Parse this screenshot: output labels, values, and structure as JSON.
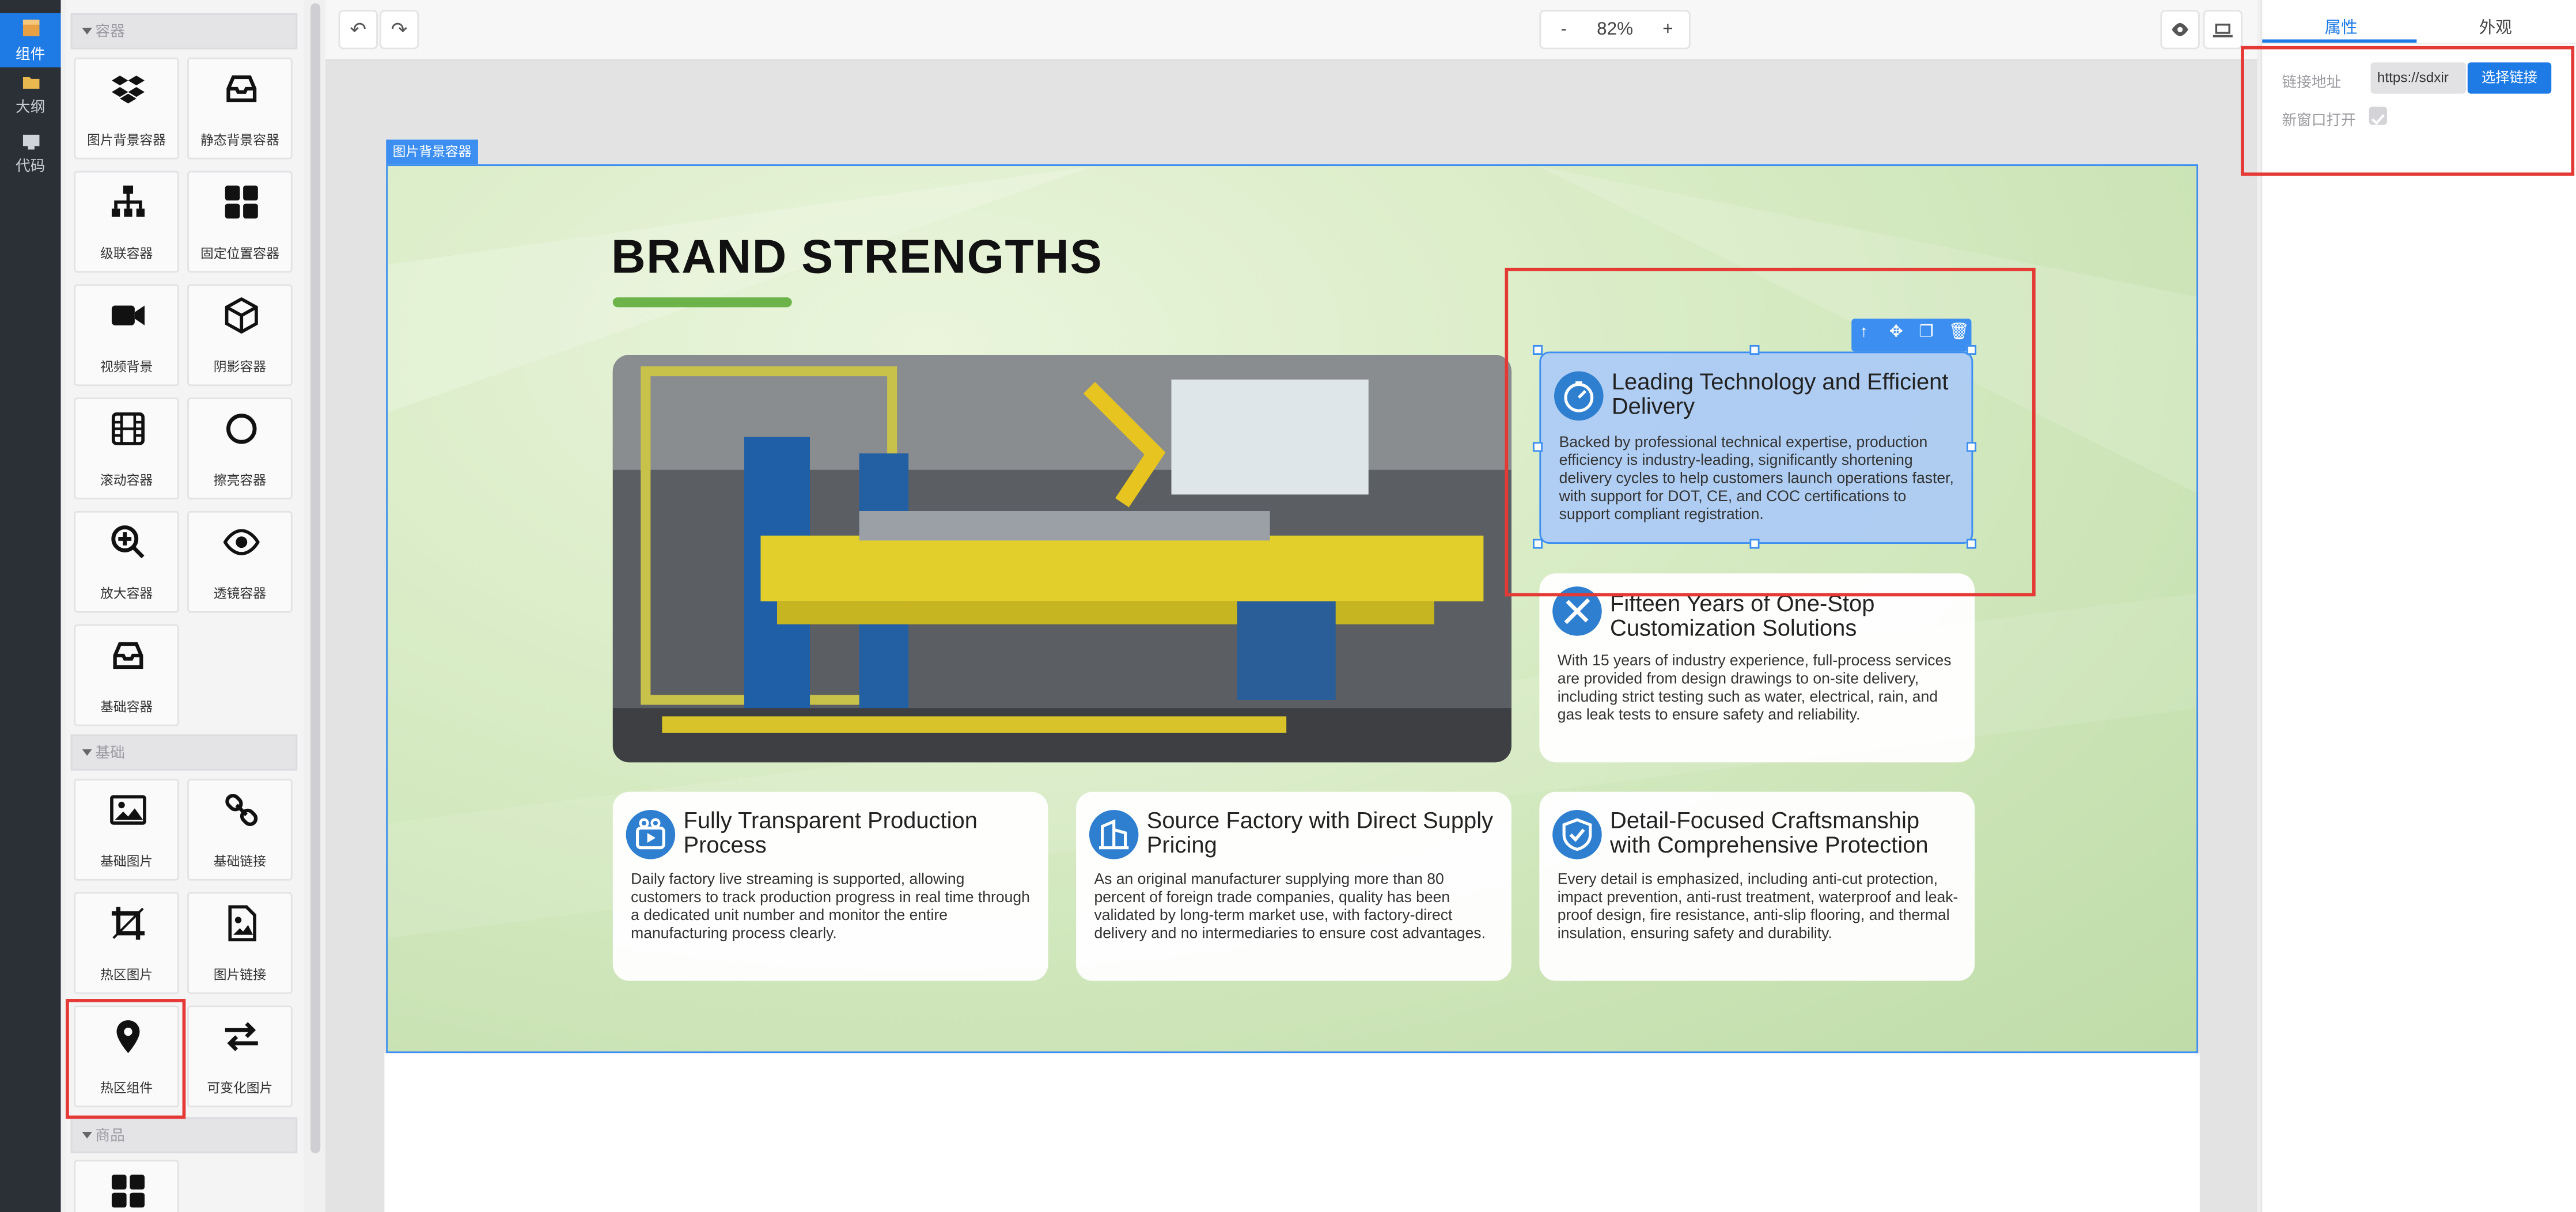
{
  "rail": {
    "items": [
      {
        "label": "组件",
        "icon": "cube-icon"
      },
      {
        "label": "大纲",
        "icon": "folder-icon"
      },
      {
        "label": "代码",
        "icon": "monitor-icon"
      }
    ]
  },
  "panel": {
    "sections": [
      "容器",
      "基础",
      "商品"
    ],
    "container_tiles": [
      {
        "label": "图片背景容器",
        "icon": "dropbox-icon"
      },
      {
        "label": "静态背景容器",
        "icon": "inbox-icon"
      },
      {
        "label": "级联容器",
        "icon": "sitemap-icon"
      },
      {
        "label": "固定位置容器",
        "icon": "grid-icon"
      },
      {
        "label": "视频背景",
        "icon": "video-icon"
      },
      {
        "label": "阴影容器",
        "icon": "box-icon"
      },
      {
        "label": "滚动容器",
        "icon": "film-icon"
      },
      {
        "label": "擦亮容器",
        "icon": "circle-icon"
      },
      {
        "label": "放大容器",
        "icon": "zoom-in-icon"
      },
      {
        "label": "透镜容器",
        "icon": "eye-icon"
      },
      {
        "label": "基础容器",
        "icon": "inbox-icon"
      }
    ],
    "basic_tiles": [
      {
        "label": "基础图片",
        "icon": "image-icon"
      },
      {
        "label": "基础链接",
        "icon": "link-icon"
      },
      {
        "label": "热区图片",
        "icon": "crop-icon"
      },
      {
        "label": "图片链接",
        "icon": "file-image-icon"
      },
      {
        "label": "热区组件",
        "icon": "map-pin-icon"
      },
      {
        "label": "可变化图片",
        "icon": "swap-icon"
      }
    ]
  },
  "toolbar": {
    "undo": "↶",
    "redo": "↷",
    "zoom_minus": "-",
    "zoom_value": "82%",
    "zoom_plus": "+",
    "preview_icon": "eye-icon",
    "device_icon": "laptop-icon"
  },
  "canvas": {
    "container_tag": "图片背景容器",
    "title": "BRAND STRENGTHS",
    "cards": [
      {
        "title": "Leading Technology and Efficient Delivery",
        "icon": "speed-icon",
        "desc": "Backed by professional technical expertise, production efficiency is industry-leading, significantly shortening delivery cycles to help customers launch operations faster, with support for DOT, CE, and COC certifications to support compliant registration."
      },
      {
        "title": "Fifteen Years of One-Stop Customization Solutions",
        "icon": "tools-icon",
        "desc": "With 15 years of industry experience, full-process services are provided from design drawings to on-site delivery, including strict testing such as water, electrical, rain, and gas leak tests to ensure safety and reliability."
      },
      {
        "title": "Fully Transparent Production Process",
        "icon": "video-play-icon",
        "desc": "Daily factory live streaming is supported, allowing customers to track production progress in real time through a dedicated unit number and monitor the entire manufacturing process clearly."
      },
      {
        "title": "Source Factory with Direct Supply Pricing",
        "icon": "building-icon",
        "desc": "As an original manufacturer supplying more than 80 percent of foreign trade companies, quality has been validated by long-term market use, with factory-direct delivery and no intermediaries to ensure cost advantages."
      },
      {
        "title": "Detail-Focused Craftsmanship with Comprehensive Protection",
        "icon": "shield-check-icon",
        "desc": "Every detail is emphasized, including anti-cut protection, impact prevention, anti-rust treatment, waterproof and leak-proof design, fire resistance, anti-slip flooring, and thermal insulation, ensuring safety and durability."
      }
    ]
  },
  "props": {
    "tab_properties": "属性",
    "tab_appearance": "外观",
    "link_label": "链接地址",
    "link_value": "https://sdxir",
    "choose_link": "选择链接",
    "new_window_label": "新窗口打开"
  },
  "colors": {
    "accent": "#1e7be6",
    "highlight": "#e53935",
    "brand_green": "#6cb34a"
  }
}
